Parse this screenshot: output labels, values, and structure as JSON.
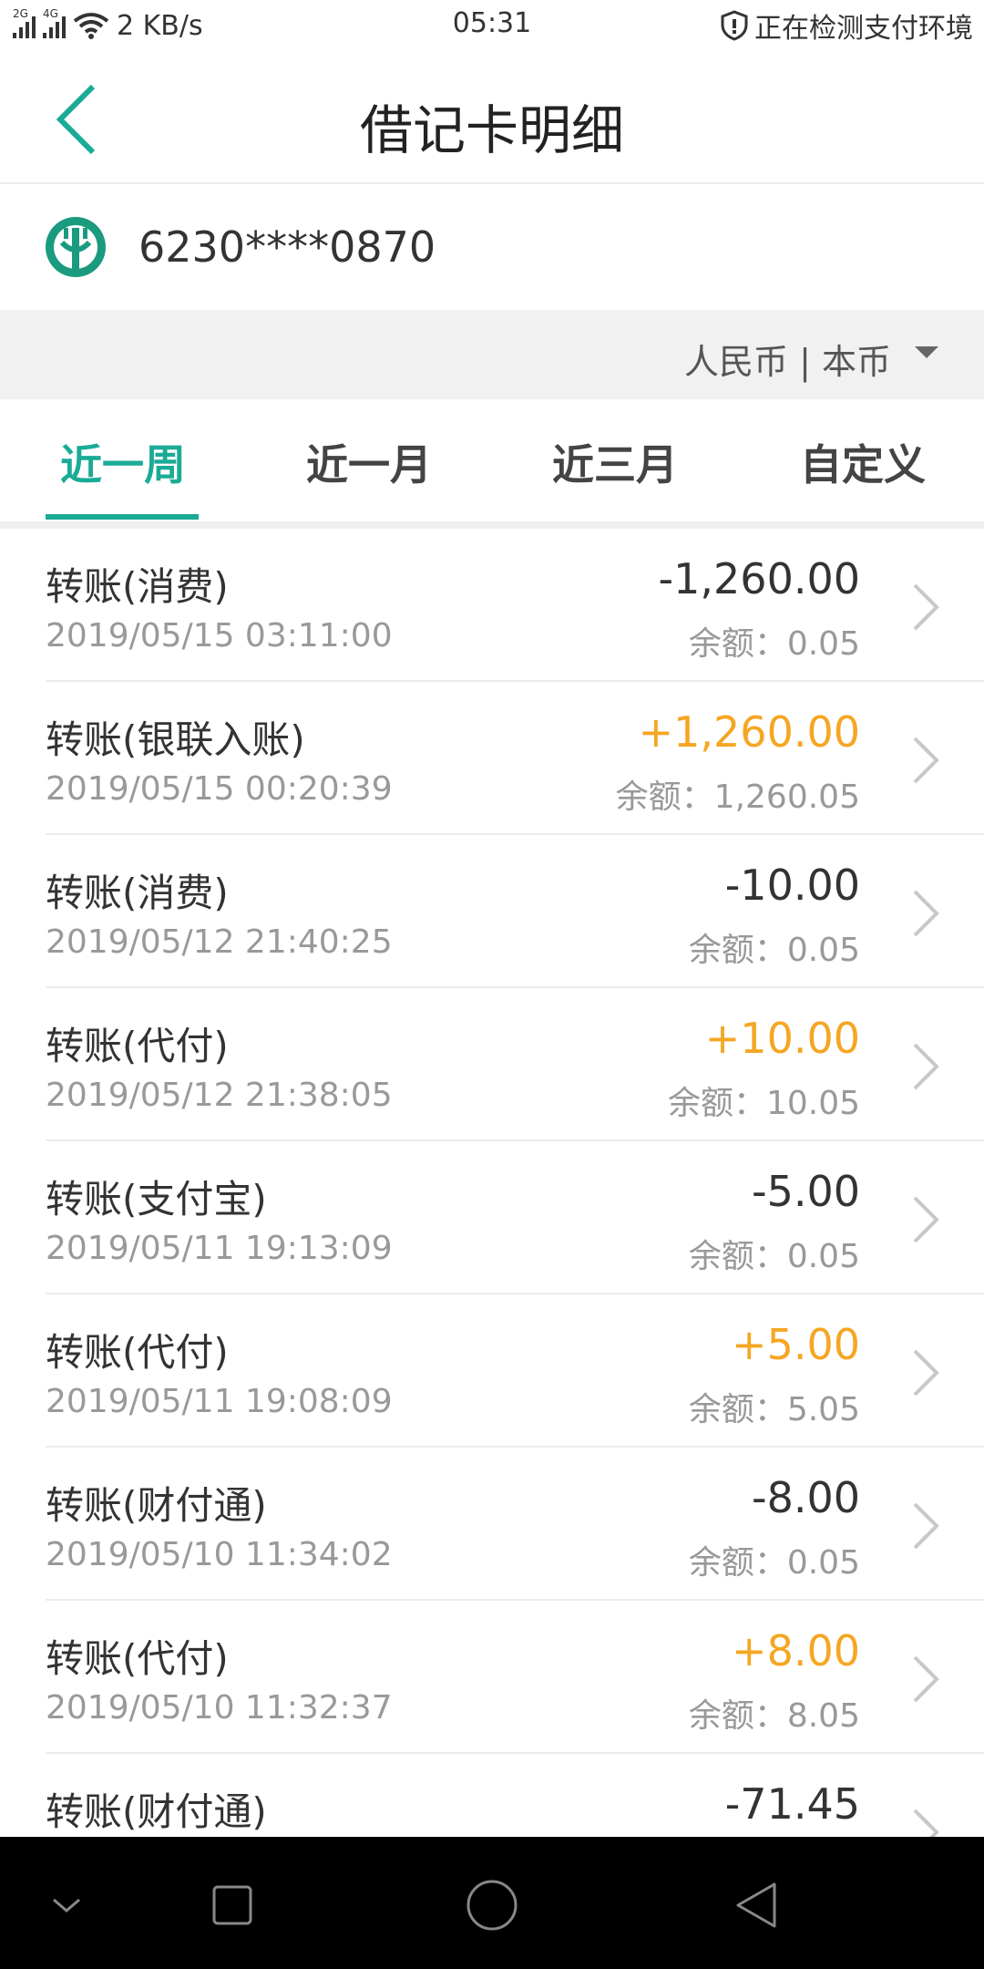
{
  "status_bar": {
    "sim1": "2G",
    "sim2": "4G",
    "speed": "2 KB/s",
    "time": "05:31",
    "security_text": "正在检测支付环境"
  },
  "header": {
    "title": "借记卡明细",
    "back_icon": "chevron-left-icon"
  },
  "card": {
    "logo_icon": "abc-bank-logo",
    "number": "6230****0870"
  },
  "currency": {
    "label": "人民币 | 本币"
  },
  "tabs": [
    {
      "label": "近一周",
      "active": true
    },
    {
      "label": "近一月",
      "active": false
    },
    {
      "label": "近三月",
      "active": false
    },
    {
      "label": "自定义",
      "active": false
    }
  ],
  "transactions": [
    {
      "title": "转账(消费)",
      "date": "2019/05/15 03:11:00",
      "amount": "-1,260.00",
      "balance": "余额：0.05",
      "type": "expense"
    },
    {
      "title": "转账(银联入账)",
      "date": "2019/05/15 00:20:39",
      "amount": "+1,260.00",
      "balance": "余额：1,260.05",
      "type": "income"
    },
    {
      "title": "转账(消费)",
      "date": "2019/05/12 21:40:25",
      "amount": "-10.00",
      "balance": "余额：0.05",
      "type": "expense"
    },
    {
      "title": "转账(代付)",
      "date": "2019/05/12 21:38:05",
      "amount": "+10.00",
      "balance": "余额：10.05",
      "type": "income"
    },
    {
      "title": "转账(支付宝)",
      "date": "2019/05/11 19:13:09",
      "amount": "-5.00",
      "balance": "余额：0.05",
      "type": "expense"
    },
    {
      "title": "转账(代付)",
      "date": "2019/05/11 19:08:09",
      "amount": "+5.00",
      "balance": "余额：5.05",
      "type": "income"
    },
    {
      "title": "转账(财付通)",
      "date": "2019/05/10 11:34:02",
      "amount": "-8.00",
      "balance": "余额：0.05",
      "type": "expense"
    },
    {
      "title": "转账(代付)",
      "date": "2019/05/10 11:32:37",
      "amount": "+8.00",
      "balance": "余额：8.05",
      "type": "income"
    },
    {
      "title": "转账(财付通)",
      "date": "",
      "amount": "-71.45",
      "balance": "",
      "type": "expense"
    }
  ],
  "colors": {
    "accent": "#1aab96",
    "income": "#f5a623",
    "expense": "#333333"
  },
  "navbar": {
    "icons": [
      "chevron-down-icon",
      "square-icon",
      "circle-icon",
      "triangle-back-icon"
    ]
  }
}
